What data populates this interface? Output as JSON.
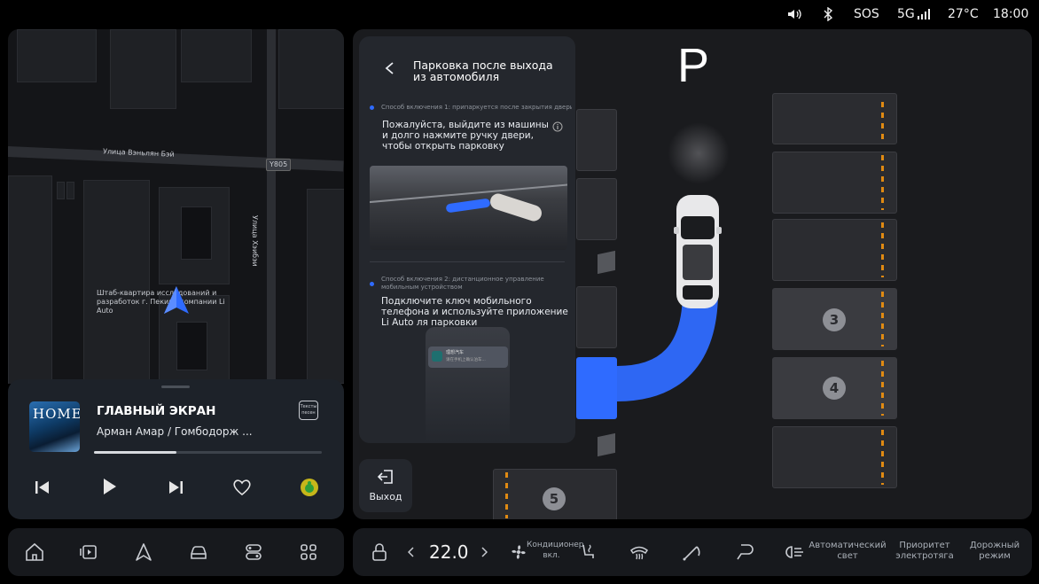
{
  "status": {
    "sos": "SOS",
    "network": "5G",
    "temperature": "27°C",
    "time": "18:00"
  },
  "map": {
    "street1": "Улица Вэньлян Бэй",
    "street2": "Улица Хэибэи",
    "road_badge": "Y805",
    "poi": "Штаб-квартира исследований и разработок г. Пекина компании Li Auto"
  },
  "music": {
    "cover_text": "HOME",
    "title": "ГЛАВНЫЙ ЭКРАН",
    "artist": "Арман Амар / Гомбодорж ...",
    "lyrics_button": "Тексты песен",
    "progress": 0.36
  },
  "parking": {
    "gear": "P",
    "slot_numbers": [
      "3",
      "4",
      "5"
    ]
  },
  "instruction": {
    "title": "Парковка после выхода из автомобиля",
    "method1_label": "Способ включения 1: припаркуется после закрытия двери",
    "method1_text": "Пожалуйста, выйдите из машины и долго нажмите ручку двери, чтобы открыть парковку",
    "method2_label": "Способ включения 2: дистанционное управление мобильным устройством",
    "method2_text": "Подключите ключ мобильного телефона и используйте приложение Li Auto ля парковки",
    "phone_app": "理想汽车",
    "phone_notice": "请在手机上确认泊车..."
  },
  "exit_label": "Выход",
  "climate": {
    "temperature": "22.0",
    "ac_status": "Кондиционер вкл.",
    "auto_light": "Автоматический свет",
    "power_priority": "Приоритет электротяга",
    "road_mode": "Дорожный режим"
  },
  "colors": {
    "accent": "#2f6bff",
    "parking_line": "#e08a12",
    "panel": "#24272d"
  }
}
